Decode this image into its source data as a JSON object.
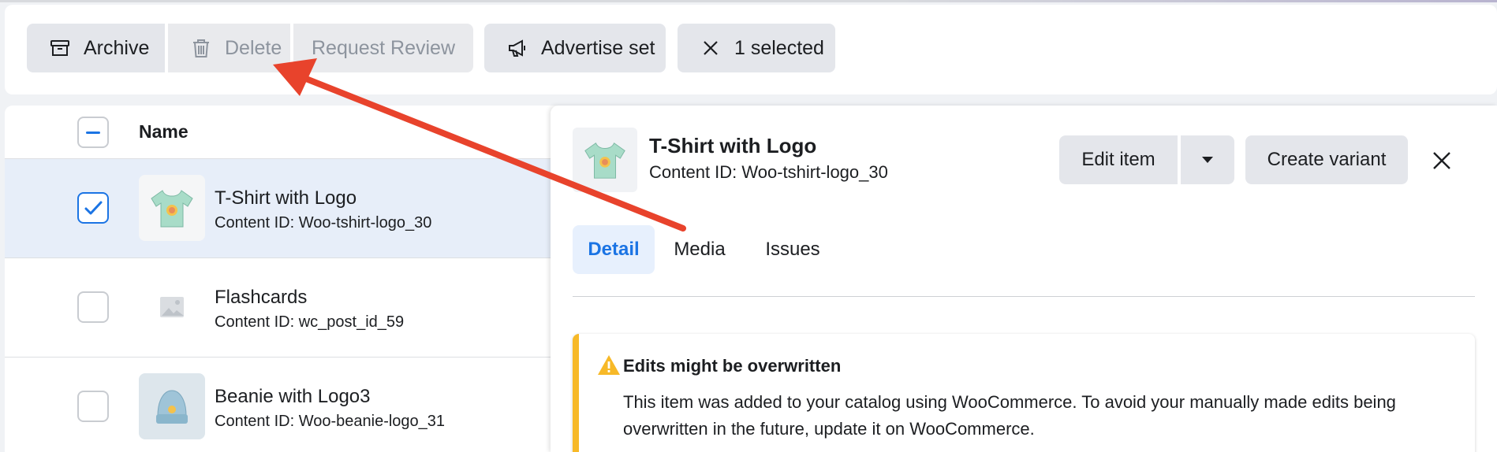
{
  "toolbar": {
    "archive_label": "Archive",
    "delete_label": "Delete",
    "review_label": "Request Review",
    "advertise_label": "Advertise set",
    "selected_label": "1 selected"
  },
  "table": {
    "header_name": "Name",
    "rows": [
      {
        "title": "T-Shirt with Logo",
        "content_id": "Content ID: Woo-tshirt-logo_30",
        "checked": true
      },
      {
        "title": "Flashcards",
        "content_id": "Content ID: wc_post_id_59",
        "checked": false
      },
      {
        "title": "Beanie with Logo3",
        "content_id": "Content ID: Woo-beanie-logo_31",
        "checked": false
      }
    ]
  },
  "detail": {
    "title": "T-Shirt with Logo",
    "content_id": "Content ID: Woo-tshirt-logo_30",
    "edit_label": "Edit item",
    "variant_label": "Create variant",
    "tabs": [
      {
        "label": "Detail",
        "active": true
      },
      {
        "label": "Media",
        "active": false
      },
      {
        "label": "Issues",
        "active": false
      }
    ],
    "alert": {
      "title": "Edits might be overwritten",
      "body": "This item was added to your catalog using WooCommerce. To avoid your manually made edits being overwritten in the future, update it on WooCommerce."
    }
  },
  "colors": {
    "accent": "#1b74e4",
    "warning": "#f7b928",
    "arrow": "#e8432c",
    "selected_row": "#e7eef9"
  }
}
